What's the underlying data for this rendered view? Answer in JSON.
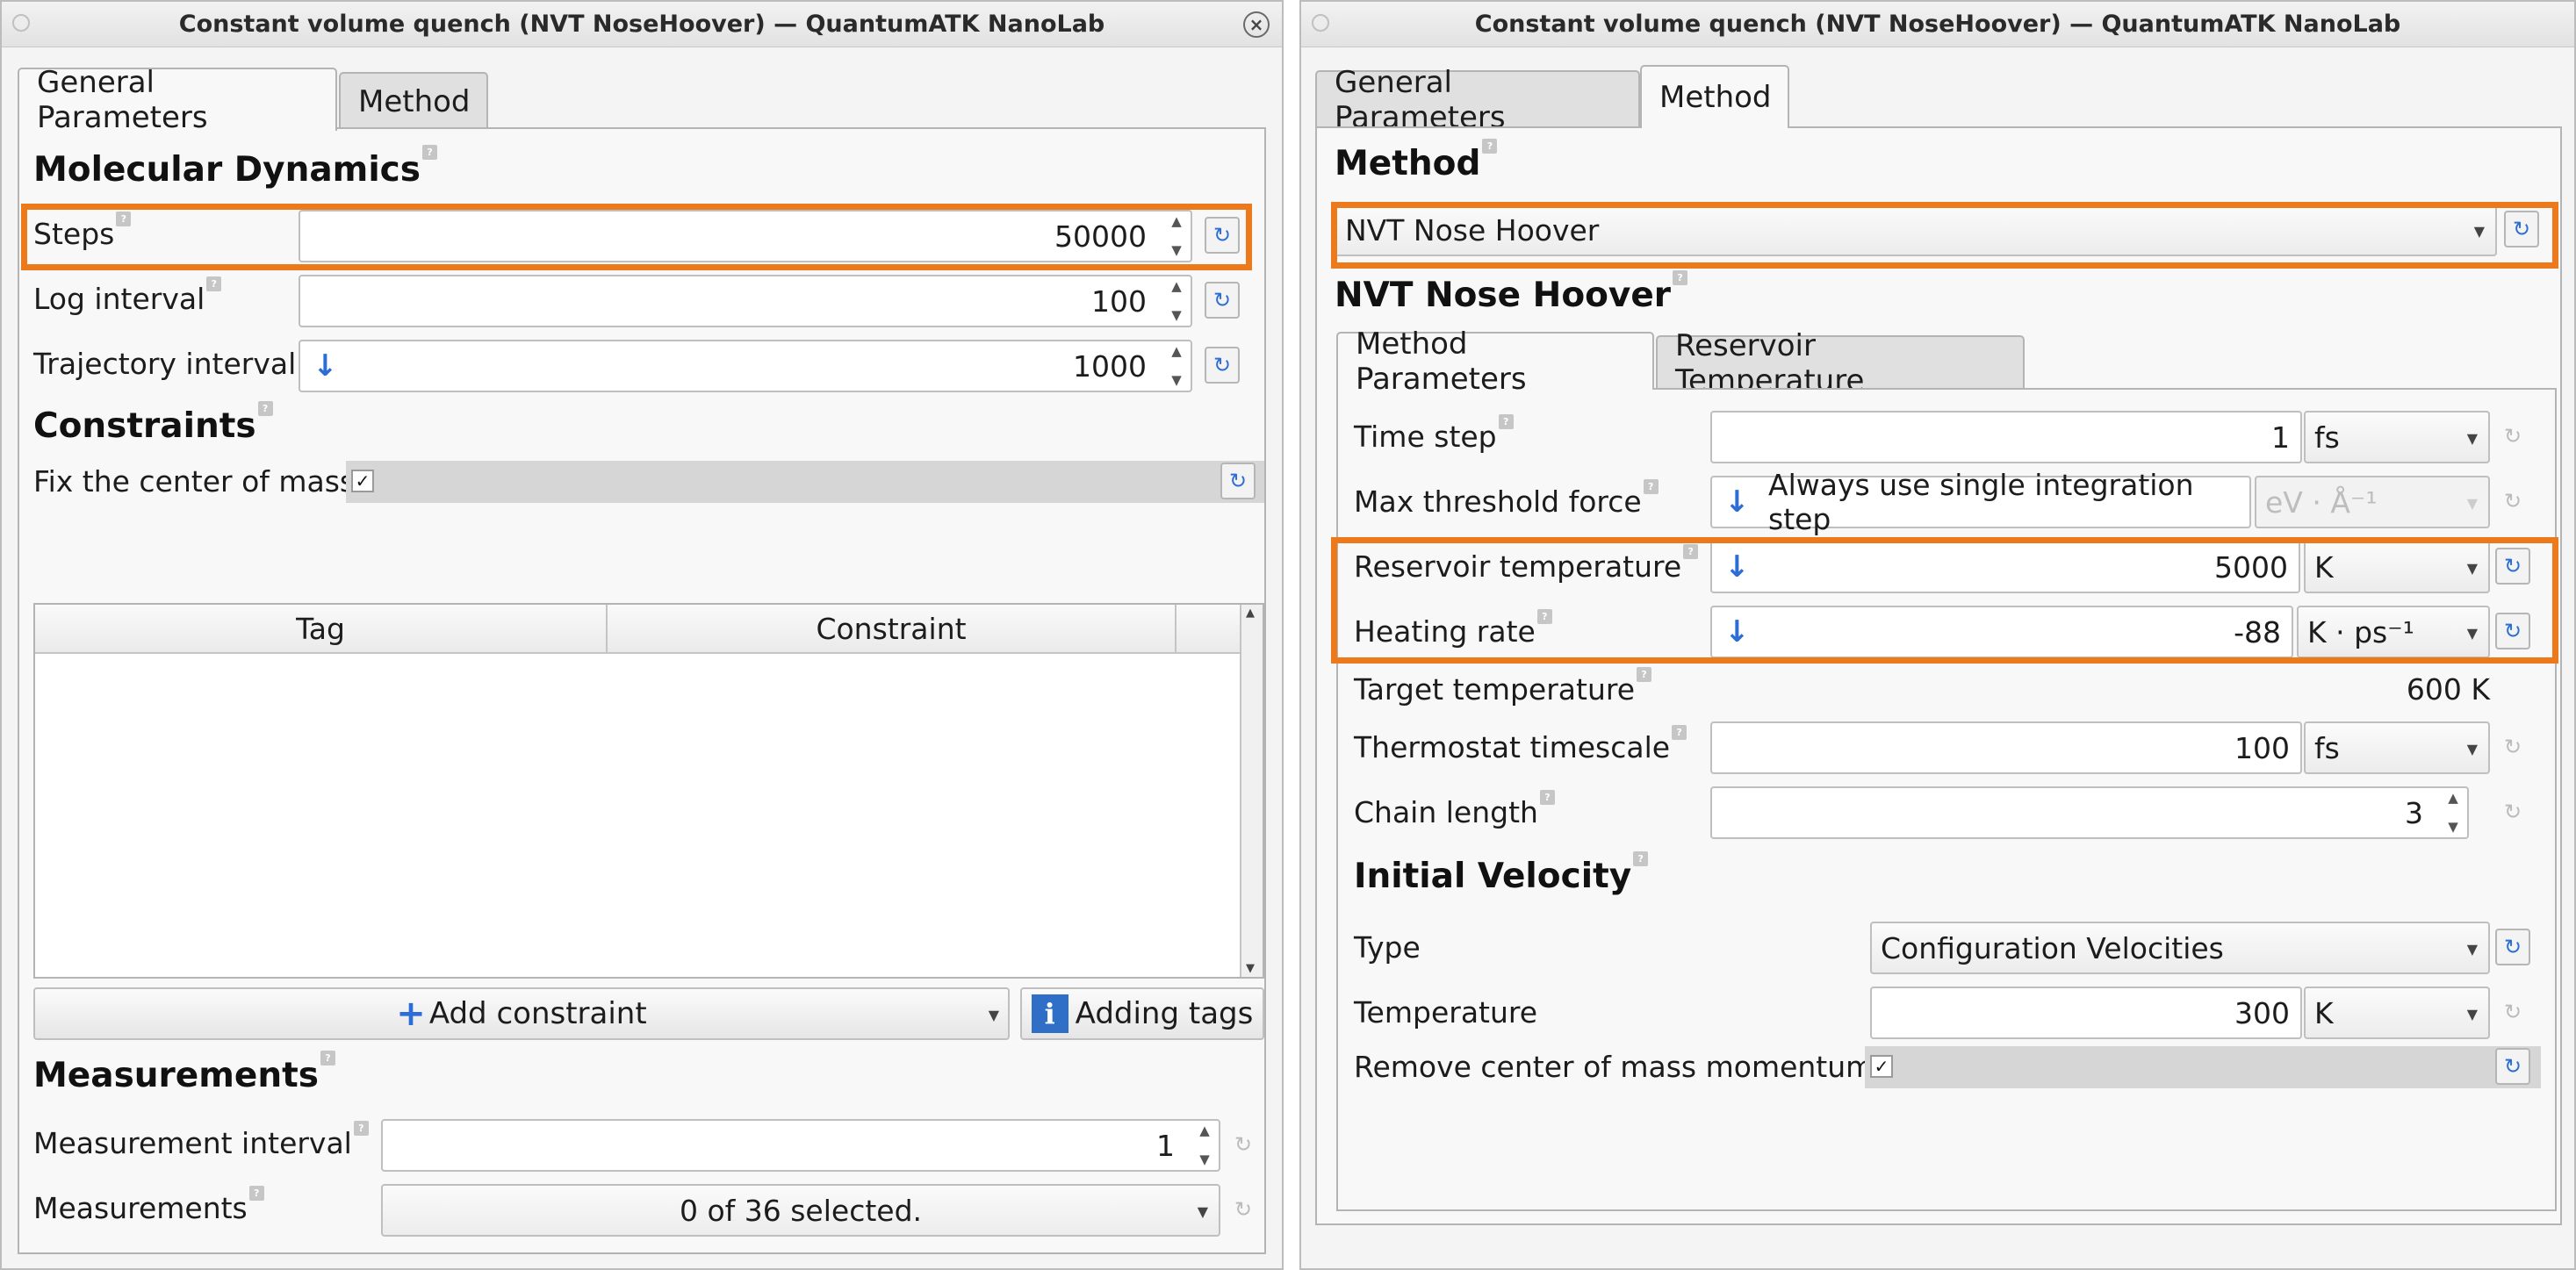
{
  "left_window": {
    "title": "Constant volume quench (NVT NoseHoover) — QuantumATK NanoLab",
    "tabs": [
      "General Parameters",
      "Method"
    ],
    "md_heading": "Molecular Dynamics",
    "steps_label": "Steps",
    "steps_value": "50000",
    "log_interval_label": "Log interval",
    "log_interval_value": "100",
    "traj_interval_label": "Trajectory interval",
    "traj_interval_value": "1000",
    "constraints_heading": "Constraints",
    "fix_com_label": "Fix the center of mass",
    "fix_com_checked": "✓",
    "table_headers": [
      "Tag",
      "Constraint"
    ],
    "add_constraint_label": "Add constraint",
    "adding_tags_label": "Adding tags",
    "measurements_heading": "Measurements",
    "meas_interval_label": "Measurement interval",
    "meas_interval_value": "1",
    "measurements_label": "Measurements",
    "measurements_value": "0 of 36 selected."
  },
  "right_window": {
    "title": "Constant volume quench (NVT NoseHoover) — QuantumATK NanoLab",
    "tabs": [
      "General Parameters",
      "Method"
    ],
    "method_heading": "Method",
    "method_value": "NVT Nose Hoover",
    "nvt_heading": "NVT Nose Hoover",
    "subtabs": [
      "Method Parameters",
      "Reservoir Temperature"
    ],
    "time_step_label": "Time step",
    "time_step_value": "1",
    "time_step_unit": "fs",
    "max_force_label": "Max threshold force",
    "max_force_value": "Always use single integration step",
    "max_force_unit": "eV · Å⁻¹",
    "reservoir_temp_label": "Reservoir temperature",
    "reservoir_temp_value": "5000",
    "reservoir_temp_unit": "K",
    "heating_rate_label": "Heating rate",
    "heating_rate_value": "-88",
    "heating_rate_unit": "K · ps⁻¹",
    "target_temp_label": "Target temperature",
    "target_temp_value": "600 K",
    "thermostat_label": "Thermostat timescale",
    "thermostat_value": "100",
    "thermostat_unit": "fs",
    "chain_length_label": "Chain length",
    "chain_length_value": "3",
    "init_vel_heading": "Initial Velocity",
    "type_label": "Type",
    "type_value": "Configuration Velocities",
    "temperature_label": "Temperature",
    "temperature_value": "300",
    "temperature_unit": "K",
    "remove_com_label": "Remove center of mass momentum",
    "remove_com_checked": "✓"
  },
  "colors": {
    "highlight": "#ec7a1c",
    "accent": "#2d6ed6"
  }
}
